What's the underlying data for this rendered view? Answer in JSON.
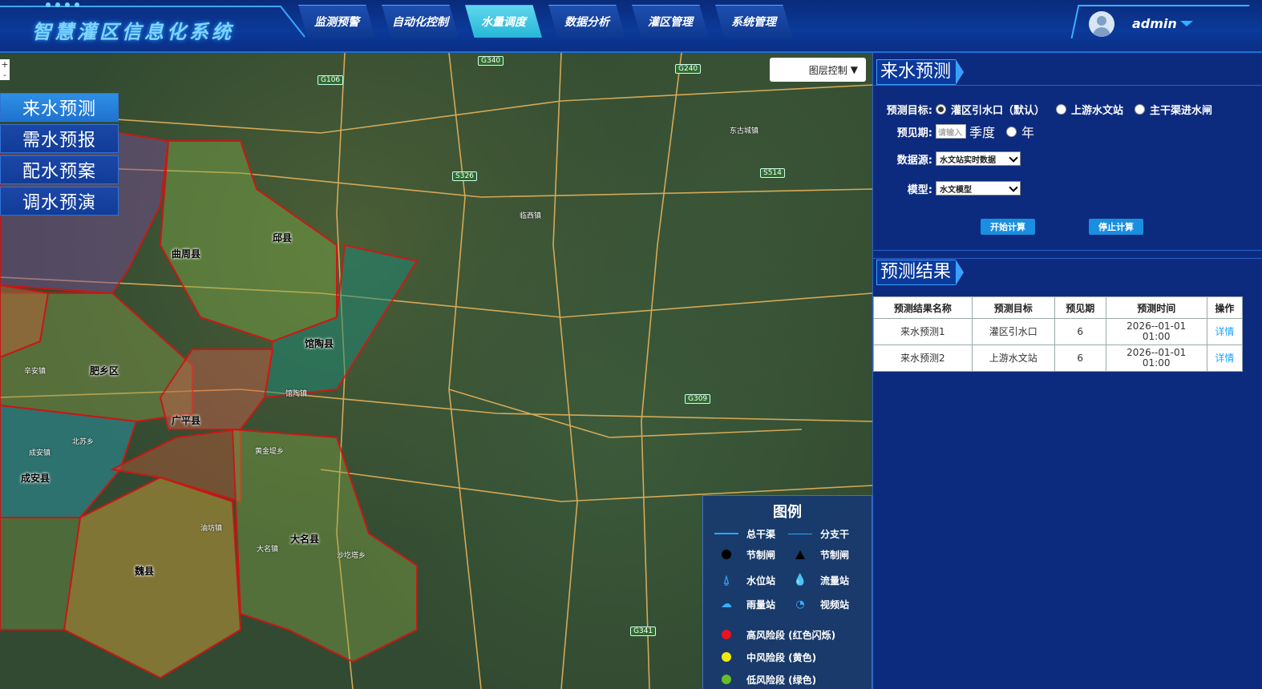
{
  "app": {
    "title": "智慧灌区信息化系统"
  },
  "nav": {
    "tabs": [
      {
        "label": "监测预警"
      },
      {
        "label": "自动化控制"
      },
      {
        "label": "水量调度"
      },
      {
        "label": "数据分析"
      },
      {
        "label": "灌区管理"
      },
      {
        "label": "系统管理"
      }
    ],
    "active_tab": "水量调度"
  },
  "user": {
    "name": "admin"
  },
  "side_menu": {
    "items": [
      {
        "label": "来水预测"
      },
      {
        "label": "需水预报"
      },
      {
        "label": "配水预案"
      },
      {
        "label": "调水预演"
      }
    ],
    "active": "来水预测"
  },
  "map": {
    "layer_control_label": "图层控制",
    "zoom_in": "+",
    "zoom_out": "-",
    "counties": [
      "邱县",
      "馆陶县",
      "肥乡区",
      "广平县",
      "成安县",
      "魏县",
      "大名县",
      "曲周县"
    ],
    "towns": [
      "魏县",
      "邱县",
      "北苏乡",
      "成安镇",
      "辛安镇",
      "大名镇",
      "临西镇",
      "馆陶镇",
      "东古城镇",
      "油坊镇",
      "黄金堤乡",
      "沙圪塔乡"
    ],
    "routes": [
      "G106",
      "G240",
      "G340",
      "S326",
      "S514",
      "G309",
      "G341"
    ]
  },
  "legend": {
    "title": "图例",
    "items": [
      {
        "label": "总干渠",
        "icon": "main-canal-line-icon"
      },
      {
        "label": "分支干",
        "icon": "branch-canal-line-icon"
      },
      {
        "label": "节制闸",
        "icon": "circle-gate-icon"
      },
      {
        "label": "节制闸",
        "icon": "triangle-gate-icon"
      },
      {
        "label": "水位站",
        "icon": "water-level-icon"
      },
      {
        "label": "流量站",
        "icon": "flow-drop-icon"
      },
      {
        "label": "雨量站",
        "icon": "rain-cloud-icon"
      },
      {
        "label": "视频站",
        "icon": "video-camera-icon"
      },
      {
        "label": "高风险段 (红色闪烁)",
        "icon": "red-dot-icon",
        "color": "#e8141e"
      },
      {
        "label": "中风险段 (黄色)",
        "icon": "yellow-dot-icon",
        "color": "#f2e80a"
      },
      {
        "label": "低风险段 (绿色)",
        "icon": "green-dot-icon",
        "color": "#6aba2a"
      }
    ]
  },
  "forecast": {
    "section_title": "来水预测",
    "target_label": "预测目标:",
    "target_options": [
      {
        "label": "灌区引水口（默认）",
        "checked": true
      },
      {
        "label": "上游水文站",
        "checked": false
      },
      {
        "label": "主干渠进水闸",
        "checked": false
      }
    ],
    "period_label": "预见期:",
    "period_placeholder": "请输入",
    "period_units": [
      "季度",
      "年"
    ],
    "source_label": "数据源:",
    "source_value": "水文站实时数据",
    "model_label": "模型:",
    "model_value": "水文模型",
    "start_button": "开始计算",
    "stop_button": "停止计算"
  },
  "results": {
    "section_title": "预测结果",
    "columns": [
      "预测结果名称",
      "预测目标",
      "预见期",
      "预测时间",
      "操作"
    ],
    "rows": [
      {
        "name": "来水预测1",
        "target": "灌区引水口",
        "period": "6",
        "time_date": "2026--01-01",
        "time_clock": "01:00",
        "action": "详情"
      },
      {
        "name": "来水预测2",
        "target": "上游水文站",
        "period": "6",
        "time_date": "2026--01-01",
        "time_clock": "01:00",
        "action": "详情"
      }
    ]
  }
}
